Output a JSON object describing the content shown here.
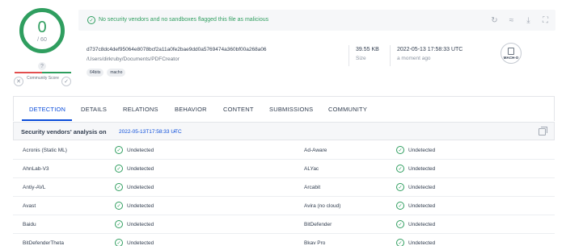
{
  "score": {
    "value": "0",
    "total": "/ 60"
  },
  "community_score": {
    "help": "?",
    "label": "Community Score",
    "dislike": "✕",
    "like": "✓"
  },
  "banner": {
    "message": "No security vendors and no sandboxes flagged this file as malicious",
    "tools": [
      "reanalyze-icon",
      "similar-icon",
      "download-icon",
      "graph-icon"
    ]
  },
  "file": {
    "hash": "d737c8dc4def95064e8078bcf2a11a0fe2bae9dd0a5769474a360bf00a268a06",
    "path": "/Users/dirkruby/Documents/PDFCreator",
    "tags": [
      "64bits",
      "macho"
    ],
    "size_value": "39.55 KB",
    "size_label": "Size",
    "date_value": "2022-05-13 17:58:33 UTC",
    "date_label": "a moment ago",
    "type_label": "MACH-O"
  },
  "tabs": [
    "DETECTION",
    "DETAILS",
    "RELATIONS",
    "BEHAVIOR",
    "CONTENT",
    "SUBMISSIONS",
    "COMMUNITY"
  ],
  "analysis": {
    "title": "Security vendors' analysis on",
    "date": "2022-05-13T17:58:33 UTC"
  },
  "vendors": [
    {
      "left": "Acronis (Static ML)",
      "left_result": "Undetected",
      "right": "Ad-Aware",
      "right_result": "Undetected"
    },
    {
      "left": "AhnLab-V3",
      "left_result": "Undetected",
      "right": "ALYac",
      "right_result": "Undetected"
    },
    {
      "left": "Antiy-AVL",
      "left_result": "Undetected",
      "right": "Arcabit",
      "right_result": "Undetected"
    },
    {
      "left": "Avast",
      "left_result": "Undetected",
      "right": "Avira (no cloud)",
      "right_result": "Undetected"
    },
    {
      "left": "Baidu",
      "left_result": "Undetected",
      "right": "BitDefender",
      "right_result": "Undetected"
    },
    {
      "left": "BitDefenderTheta",
      "left_result": "Undetected",
      "right": "Bkav Pro",
      "right_result": "Undetected"
    }
  ],
  "colors": {
    "ok": "#2f9e5f",
    "accent": "#0b4dda",
    "bad": "#e24f4f"
  }
}
